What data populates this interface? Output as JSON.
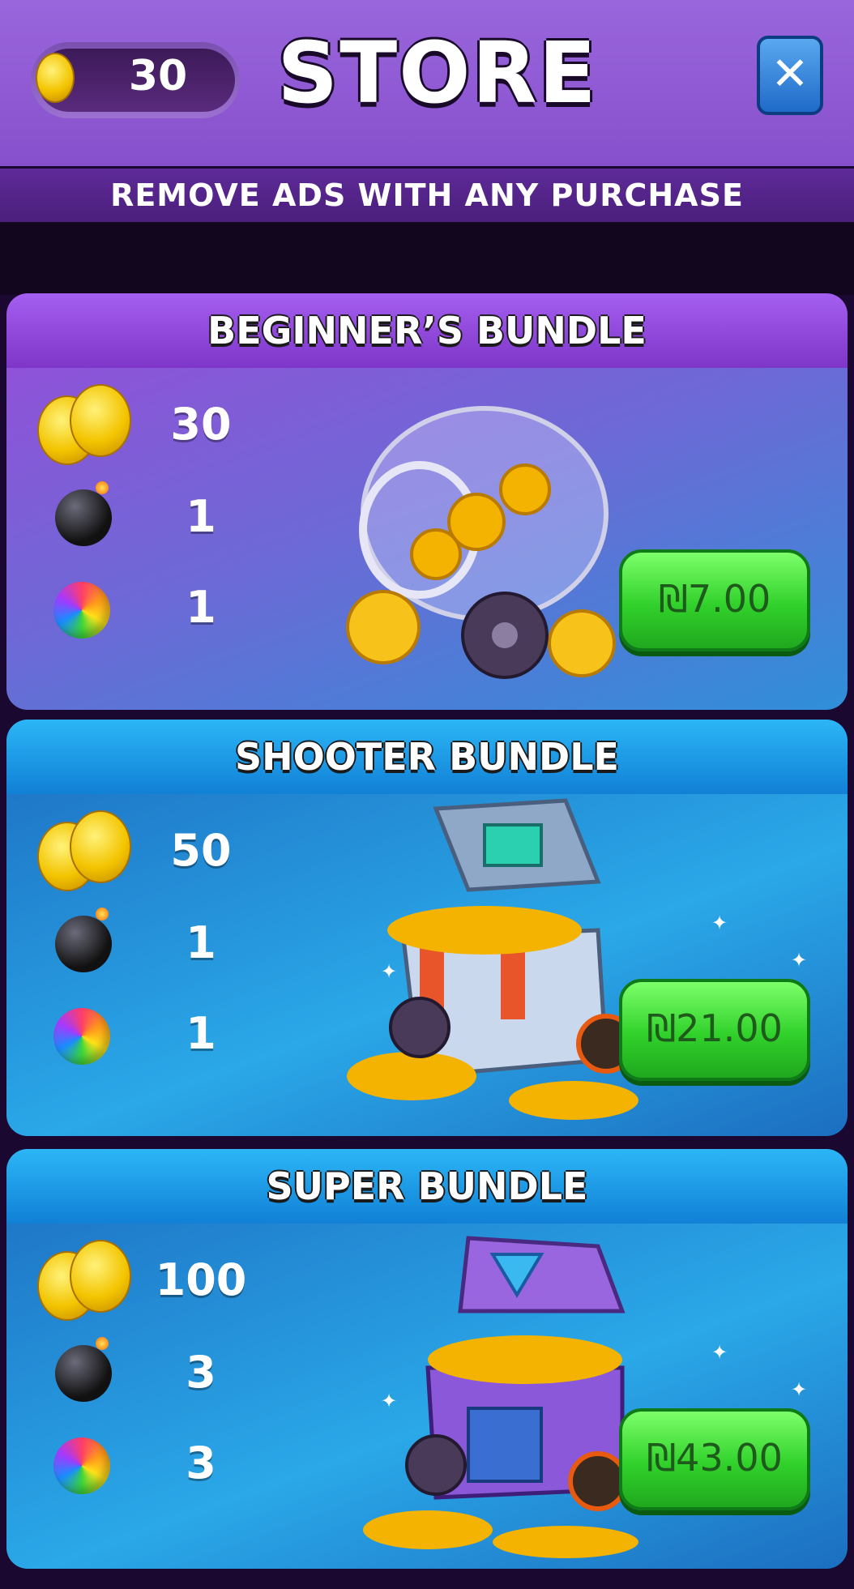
{
  "header": {
    "coin_balance": "30",
    "title": "STORE",
    "close_glyph": "✕",
    "banner": "REMOVE ADS WITH ANY PURCHASE"
  },
  "bundles": [
    {
      "title": "BEGINNER’S BUNDLE",
      "coins": "30",
      "bombs": "1",
      "candies": "1",
      "price": "₪7.00",
      "art_icon": "coin-jar-icon"
    },
    {
      "title": "SHOOTER BUNDLE",
      "coins": "50",
      "bombs": "1",
      "candies": "1",
      "price": "₪21.00",
      "art_icon": "treasure-chest-icon"
    },
    {
      "title": "SUPER BUNDLE",
      "coins": "100",
      "bombs": "3",
      "candies": "3",
      "price": "₪43.00",
      "art_icon": "purple-chest-icon"
    }
  ],
  "colors": {
    "header_purple": "#8b58d2",
    "beginner_header": "#8c44d8",
    "shooter_header": "#1a8fe0",
    "price_green": "#33d12c"
  }
}
